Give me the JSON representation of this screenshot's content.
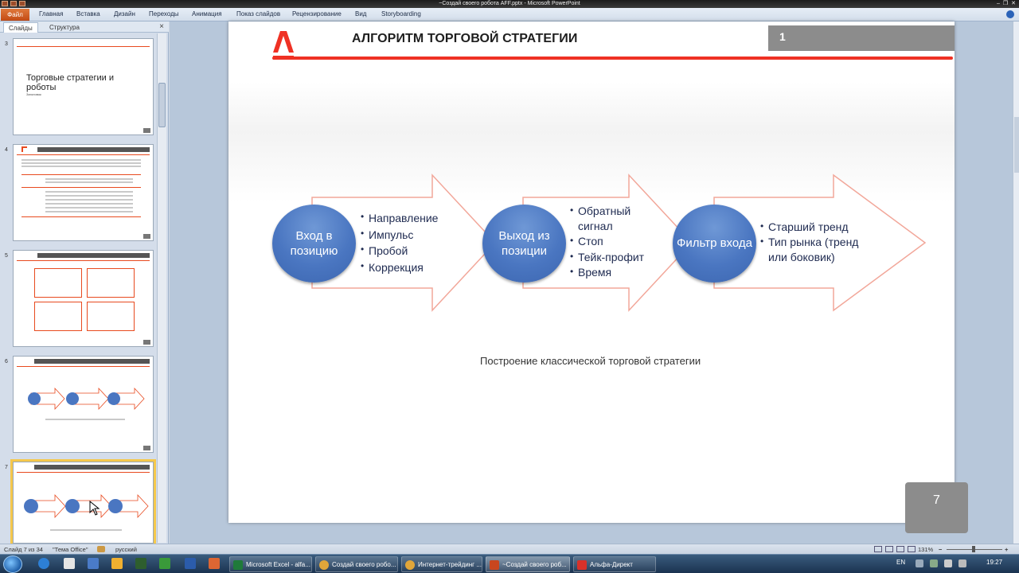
{
  "window": {
    "title": "~Создай своего робота AFF.pptx - Microsoft PowerPoint",
    "controls": [
      "–",
      "❐",
      "✕"
    ]
  },
  "ribbon": {
    "file_tab": "Файл",
    "tabs": [
      "Главная",
      "Вставка",
      "Дизайн",
      "Переходы",
      "Анимация",
      "Показ слайдов",
      "Рецензирование",
      "Вид",
      "Storyboarding"
    ]
  },
  "panel": {
    "tabs": [
      "Слайды",
      "Структура"
    ],
    "close": "×",
    "thumbnails": [
      {
        "num": "3",
        "title": "Торговые стратегии и роботы",
        "subtitle": "Заголовок"
      },
      {
        "num": "4"
      },
      {
        "num": "5"
      },
      {
        "num": "6"
      },
      {
        "num": "7",
        "selected": true
      }
    ]
  },
  "slide": {
    "title": "АЛГОРИТМ ТОРГОВОЙ СТРАТЕГИИ",
    "number_box": "1",
    "steps": [
      {
        "circle": "Вход в позицию",
        "bullets": [
          "Направление",
          "Импульс",
          "Пробой",
          "Коррекция"
        ]
      },
      {
        "circle": "Выход из позиции",
        "bullets": [
          "Обратный сигнал",
          "Стоп",
          "Тейк-профит",
          "Время"
        ]
      },
      {
        "circle": "Фильтр входа",
        "bullets": [
          "Старший тренд",
          "Тип рынка (тренд или боковик)"
        ]
      }
    ],
    "caption": "Построение классической торговой стратегии",
    "page_number": "7",
    "accent_color": "#ef3124",
    "circle_color": "#4a76c1"
  },
  "status": {
    "slide_info": "Слайд 7 из 34",
    "theme": "\"Тема Office\"",
    "language": "русский",
    "zoom": "131%",
    "zoom_fraction": 0.45
  },
  "taskbar": {
    "tasks": [
      {
        "label": "Microsoft Excel - alfa...",
        "color": "#1f7a3a"
      },
      {
        "label": "Создай своего робо...",
        "color": "#e0a63a"
      },
      {
        "label": "Интернет-трейдинг ...",
        "color": "#e0a63a"
      },
      {
        "label": "~Создай своего роб...",
        "color": "#c8461f",
        "active": true
      },
      {
        "label": "Альфа-Директ",
        "color": "#d8312a"
      }
    ],
    "lang": "EN",
    "time": "19:27"
  }
}
